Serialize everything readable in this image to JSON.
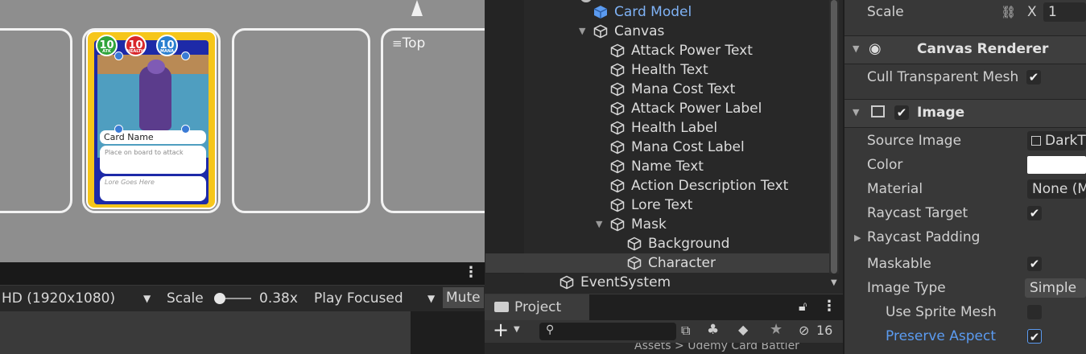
{
  "game_view": {
    "top_label": "Top",
    "card": {
      "attack": "10",
      "attack_label": "ATK",
      "health": "10",
      "health_label": "HEALTH",
      "mana": "10",
      "mana_label": "MANA",
      "name": "Card Name",
      "description": "Place on board to attack",
      "lore": "Lore Goes Here"
    },
    "toolbar": {
      "resolution": "HD (1920x1080)",
      "scale_label": "Scale",
      "scale_value": "0.38x",
      "play_mode": "Play Focused",
      "mute": "Mute"
    }
  },
  "hierarchy": {
    "rows": [
      {
        "label": "Card Model",
        "depth": "model"
      },
      {
        "label": "Canvas"
      },
      {
        "label": "Attack Power Text"
      },
      {
        "label": "Health Text"
      },
      {
        "label": "Mana Cost Text"
      },
      {
        "label": "Attack Power Label"
      },
      {
        "label": "Health Label"
      },
      {
        "label": "Mana Cost Label"
      },
      {
        "label": "Name Text"
      },
      {
        "label": "Action Description Text"
      },
      {
        "label": "Lore Text"
      },
      {
        "label": "Mask"
      },
      {
        "label": "Background"
      },
      {
        "label": "Character"
      },
      {
        "label": "EventSystem"
      }
    ]
  },
  "project": {
    "tab": "Project",
    "hidden_count": "16",
    "breadcrumb": "Assets > Udemy Card Battler"
  },
  "inspector": {
    "scale_label": "Scale",
    "scale_x_label": "X",
    "scale_x_value": "1",
    "canvas_renderer": {
      "title": "Canvas Renderer",
      "cull_label": "Cull Transparent Mesh"
    },
    "image": {
      "title": "Image",
      "source_image_label": "Source Image",
      "source_image_value": "DarkT",
      "color_label": "Color",
      "material_label": "Material",
      "material_value": "None (M",
      "raycast_target_label": "Raycast Target",
      "raycast_padding_label": "Raycast Padding",
      "maskable_label": "Maskable",
      "image_type_label": "Image Type",
      "image_type_value": "Simple",
      "use_sprite_mesh_label": "Use Sprite Mesh",
      "preserve_aspect_label": "Preserve Aspect"
    }
  },
  "colors": {
    "selection_blue": "#5b9bf0",
    "game_bg": "#8e8e8e",
    "card_gold": "#f6c61a",
    "card_blue": "#1d2aa8"
  }
}
